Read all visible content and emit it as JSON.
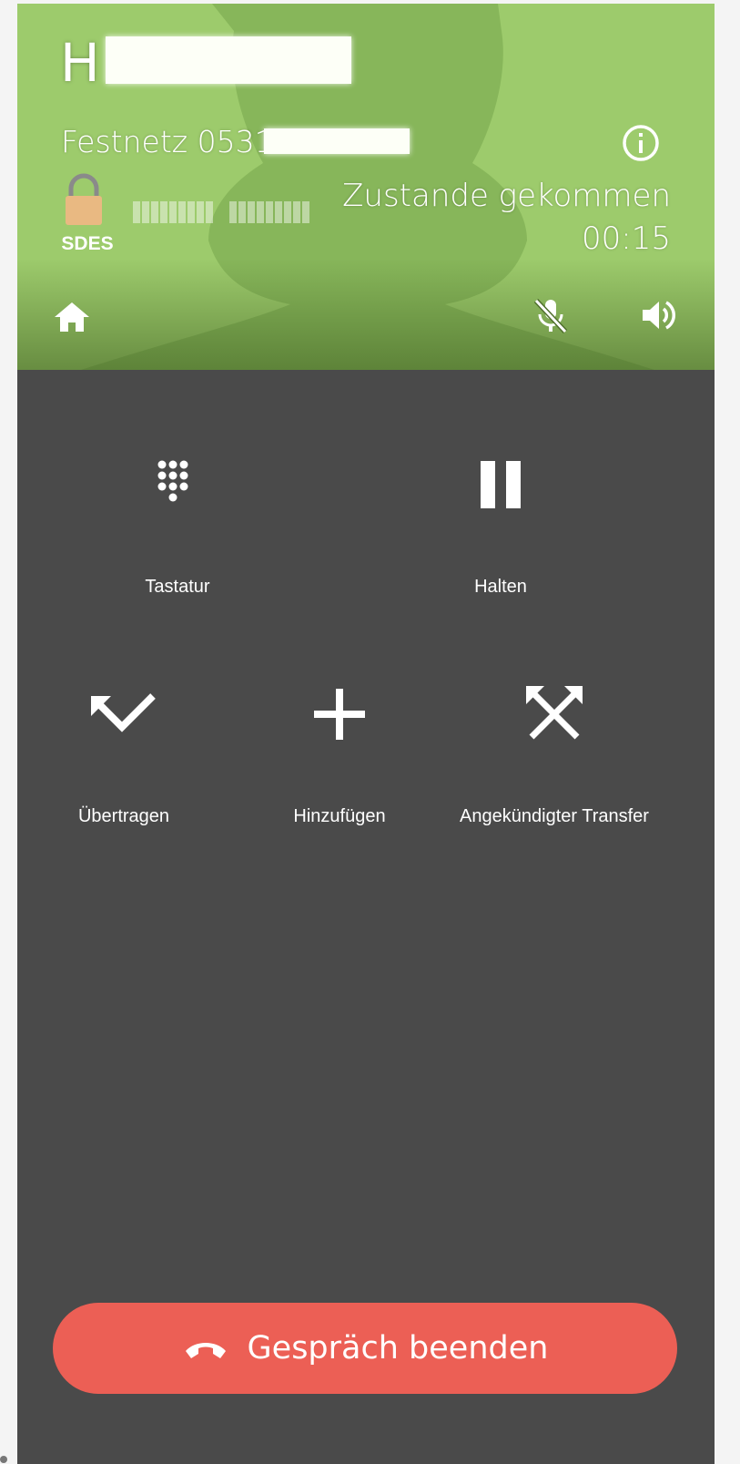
{
  "call": {
    "name_visible": "H",
    "number_visible": "Festnetz 0531",
    "status": "Zustande gekommen",
    "timer": "00:15",
    "encryption": "SDES"
  },
  "actions": [
    {
      "label": "Tastatur",
      "icon": "dialpad-icon"
    },
    {
      "label": "Halten",
      "icon": "pause-icon"
    },
    {
      "label": "Übertragen",
      "icon": "transfer-icon"
    },
    {
      "label": "Hinzufügen",
      "icon": "add-icon"
    },
    {
      "label": "Angekündigter Transfer",
      "icon": "attended-transfer-icon"
    }
  ],
  "end_call": {
    "label": "Gespräch beenden",
    "icon": "hangup-icon"
  },
  "colors": {
    "header_green": "#9dcb6c",
    "background": "#4a4a4a",
    "end_call_red": "#ec5f55",
    "lock": "#e9b982"
  }
}
